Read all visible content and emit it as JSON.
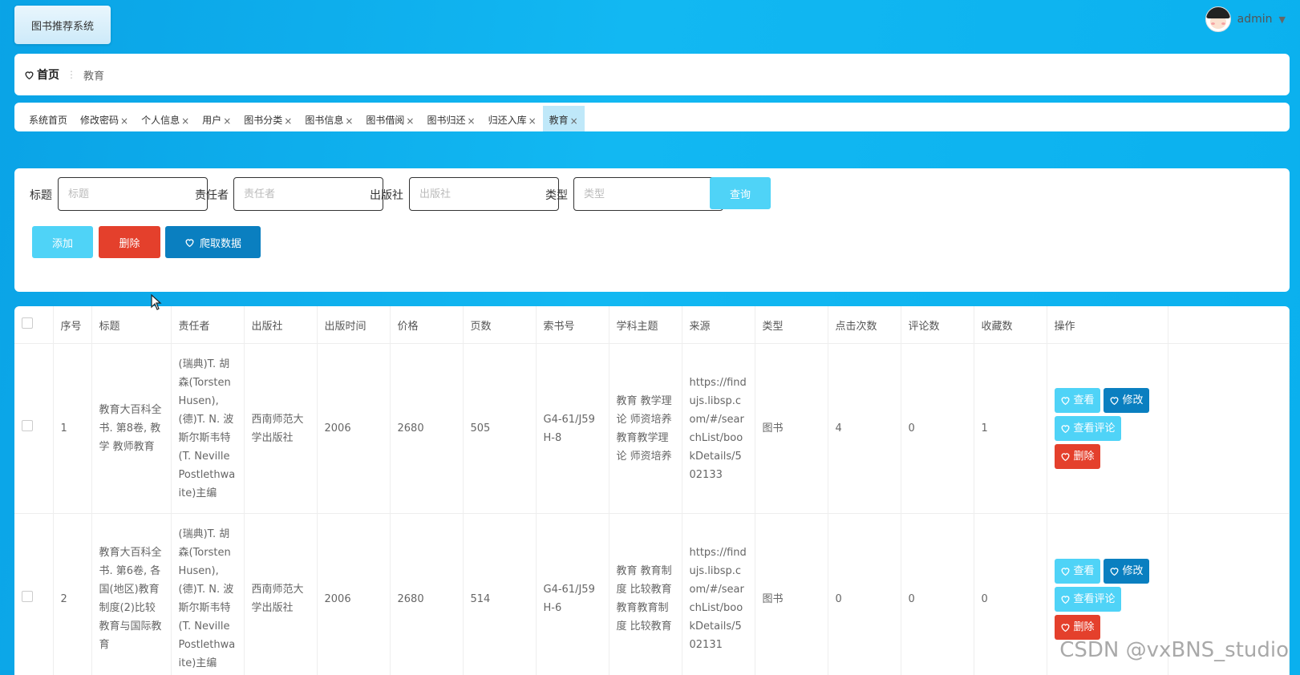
{
  "app": {
    "title": "图书推荐系统"
  },
  "user": {
    "name": "admin"
  },
  "breadcrumb": {
    "home": "首页",
    "sep": "⋮",
    "current": "教育"
  },
  "tabs": [
    {
      "label": "系统首页",
      "closable": false
    },
    {
      "label": "修改密码",
      "closable": true
    },
    {
      "label": "个人信息",
      "closable": true
    },
    {
      "label": "用户",
      "closable": true
    },
    {
      "label": "图书分类",
      "closable": true
    },
    {
      "label": "图书信息",
      "closable": true
    },
    {
      "label": "图书借阅",
      "closable": true
    },
    {
      "label": "图书归还",
      "closable": true
    },
    {
      "label": "归还入库",
      "closable": true
    },
    {
      "label": "教育",
      "closable": true,
      "active": true
    }
  ],
  "close_glyph": "×",
  "search": {
    "title_label": "标题",
    "title_placeholder": "标题",
    "author_label": "责任者",
    "author_placeholder": "责任者",
    "publisher_label": "出版社",
    "publisher_placeholder": "出版社",
    "type_label": "类型",
    "type_placeholder": "类型",
    "query_button": "查询"
  },
  "actions": {
    "add": "添加",
    "delete": "删除",
    "crawl": "爬取数据"
  },
  "table": {
    "headers": [
      "序号",
      "标题",
      "责任者",
      "出版社",
      "出版时间",
      "价格",
      "页数",
      "索书号",
      "学科主题",
      "来源",
      "类型",
      "点击次数",
      "评论数",
      "收藏数",
      "操作"
    ],
    "rows": [
      {
        "index": "1",
        "title": "教育大百科全书. 第8卷, 教学 教师教育",
        "author": "(瑞典)T. 胡森(Torsten Husen), (德)T. N. 波斯尔斯韦特(T. Neville Postlethwaite)主编",
        "publisher": "西南师范大学出版社",
        "year": "2006",
        "price": "2680",
        "pages": "505",
        "call_no": "G4-61/J59H-8",
        "subject": "教育 教学理论 师资培养 教育教学理论 师资培养",
        "source": "https://findujs.libsp.com/#/searchList/bookDetails/502133",
        "type": "图书",
        "clicks": "4",
        "comments": "0",
        "favorites": "1"
      },
      {
        "index": "2",
        "title": "教育大百科全书. 第6卷, 各国(地区)教育制度(2)比较教育与国际教育",
        "author": "(瑞典)T. 胡森(Torsten Husen), (德)T. N. 波斯尔斯韦特(T. Neville Postlethwaite)主编",
        "publisher": "西南师范大学出版社",
        "year": "2006",
        "price": "2680",
        "pages": "514",
        "call_no": "G4-61/J59H-6",
        "subject": "教育 教育制度 比较教育 教育教育制度 比较教育",
        "source": "https://findujs.libsp.com/#/searchList/bookDetails/502131",
        "type": "图书",
        "clicks": "0",
        "comments": "0",
        "favorites": "0"
      }
    ],
    "row_ops": {
      "view": "查看",
      "edit": "修改",
      "view_comments": "查看评论",
      "delete": "删除"
    }
  },
  "watermark": "CSDN @vxBNS_studio",
  "colors": {
    "accent_light": "#4fd3f7",
    "accent_blue": "#0a7fc0",
    "danger": "#e4402c",
    "bg": "#12b8f2"
  }
}
